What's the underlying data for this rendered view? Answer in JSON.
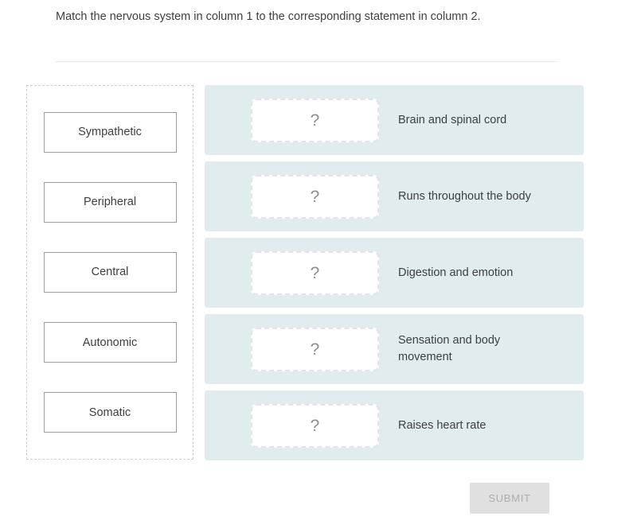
{
  "question": {
    "prompt": "Match the nervous system in column 1 to the corresponding statement in column 2."
  },
  "column1": {
    "items": [
      {
        "label": "Sympathetic"
      },
      {
        "label": "Peripheral"
      },
      {
        "label": "Central"
      },
      {
        "label": "Autonomic"
      },
      {
        "label": "Somatic"
      }
    ]
  },
  "column2": {
    "drop_placeholder": "?",
    "rows": [
      {
        "statement": "Brain and spinal cord",
        "answer": ""
      },
      {
        "statement": "Runs throughout the body",
        "answer": ""
      },
      {
        "statement": "Digestion and emotion",
        "answer": ""
      },
      {
        "statement": "Sensation and body movement",
        "answer": ""
      },
      {
        "statement": "Raises heart rate",
        "answer": ""
      }
    ]
  },
  "actions": {
    "submit_label": "SUBMIT"
  },
  "colors": {
    "row_background": "#e1ecee",
    "card_border": "#9e9e9e",
    "dropzone_border": "#e4e4e4",
    "text": "#3c4043",
    "placeholder": "#8d8d8d",
    "submit_background": "#e0e0e0",
    "submit_text": "#aeaeae",
    "divider": "#e8eaed",
    "source_zone_border": "#d0d0d0"
  }
}
